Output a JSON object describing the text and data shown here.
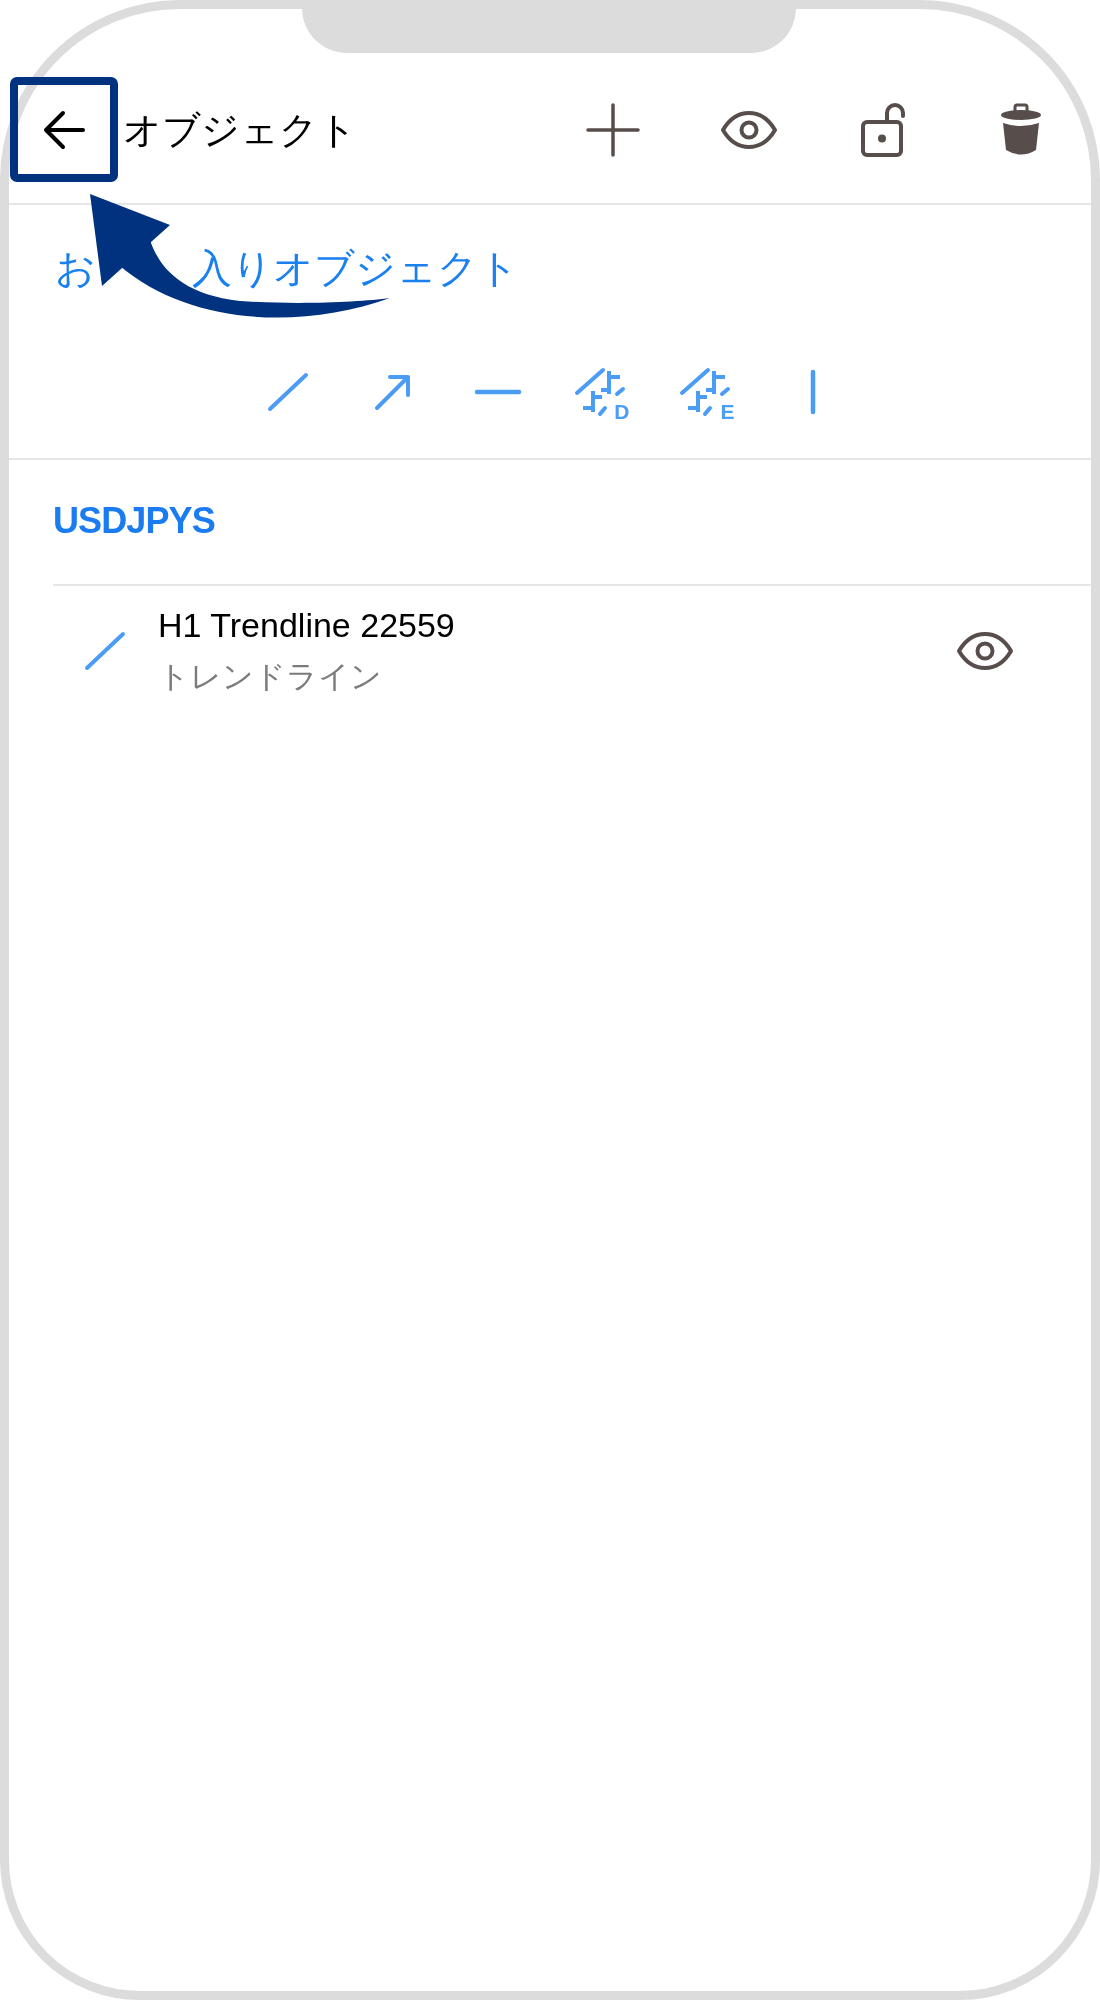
{
  "header": {
    "back_button": {
      "highlighted": true
    },
    "title": "オブジェクト",
    "actions": [
      {
        "kind": "add"
      },
      {
        "kind": "visibility"
      },
      {
        "kind": "unlock"
      },
      {
        "kind": "delete"
      }
    ]
  },
  "favorites": {
    "title_parts": [
      "お",
      "入りオブジェクト"
    ],
    "tools": [
      {
        "kind": "trendline"
      },
      {
        "kind": "arrowed_line"
      },
      {
        "kind": "horizontal_line"
      },
      {
        "kind": "marked_line",
        "letter": "D"
      },
      {
        "kind": "marked_line",
        "letter": "E"
      },
      {
        "kind": "vertical_line"
      }
    ]
  },
  "groups": [
    {
      "symbol": "USDJPYS",
      "objects": [
        {
          "kind": "trendline",
          "name": "H1 Trendline 22559",
          "type_label": "トレンドライン",
          "visible": true
        }
      ]
    }
  ]
}
